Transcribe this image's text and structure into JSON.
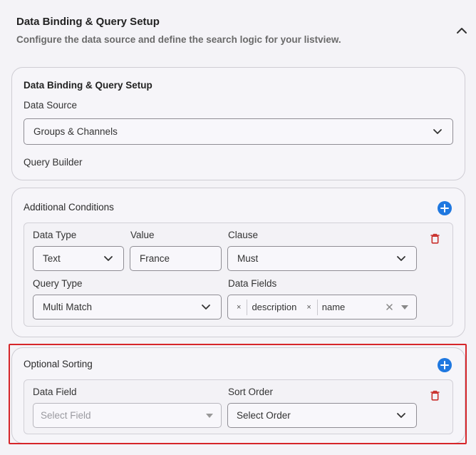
{
  "header": {
    "title": "Data Binding & Query Setup",
    "subtitle": "Configure the data source and define the search logic for your listview."
  },
  "binding": {
    "title": "Data Binding & Query Setup",
    "data_source_label": "Data Source",
    "data_source_value": "Groups & Channels",
    "query_builder_label": "Query Builder"
  },
  "conditions": {
    "title": "Additional Conditions",
    "data_type_label": "Data Type",
    "data_type_value": "Text",
    "value_label": "Value",
    "value_value": "France",
    "clause_label": "Clause",
    "clause_value": "Must",
    "query_type_label": "Query Type",
    "query_type_value": "Multi Match",
    "data_fields_label": "Data Fields",
    "data_fields": [
      "description",
      "name"
    ],
    "chip_remove": "×"
  },
  "sorting": {
    "title": "Optional Sorting",
    "data_field_label": "Data Field",
    "data_field_placeholder": "Select Field",
    "sort_order_label": "Sort Order",
    "sort_order_value": "Select Order"
  },
  "colors": {
    "accent": "#1f78e0",
    "danger": "#c9302c",
    "highlight": "#d6262a"
  }
}
